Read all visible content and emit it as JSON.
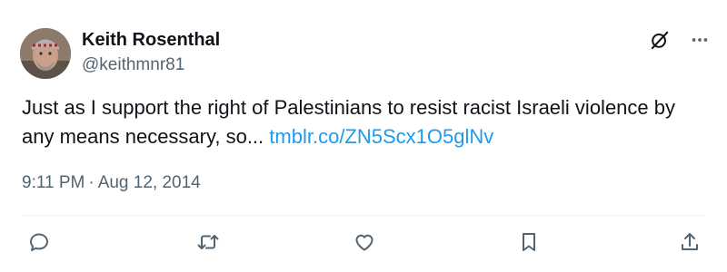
{
  "tweet": {
    "author": {
      "display_name": "Keith Rosenthal",
      "handle": "@keithmnr81"
    },
    "text": "Just as I support the right of Palestinians to resist racist Israeli violence by any means necessary, so...",
    "link": "tmblr.co/ZN5Scx1O5glNv",
    "time": "9:11 PM",
    "separator": "·",
    "date": "Aug 12, 2014"
  },
  "icons": {
    "top": [
      "grok-icon",
      "more-icon"
    ],
    "actions": [
      "reply-icon",
      "retweet-icon",
      "like-icon",
      "bookmark-icon",
      "share-icon"
    ]
  },
  "colors": {
    "text": "#0f1419",
    "secondary": "#536471",
    "link": "#1d9bf0",
    "divider": "#eff3f4"
  }
}
